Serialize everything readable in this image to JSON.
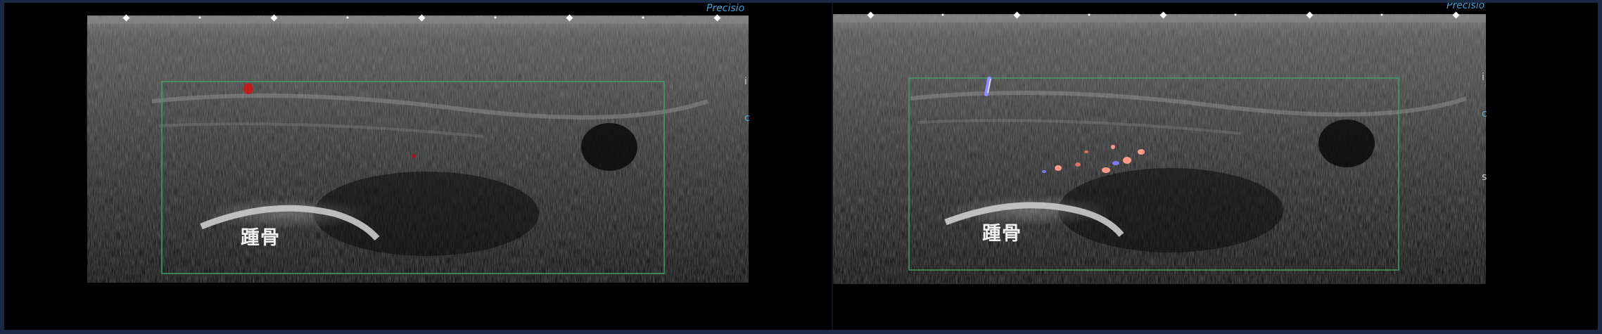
{
  "panels": [
    {
      "id": "left",
      "structure_label": "踵骨",
      "brand_text": "Precisio"
    },
    {
      "id": "right",
      "structure_label": "踵骨",
      "brand_text": "Precisio"
    }
  ],
  "colors": {
    "background": "#1a2a44",
    "roi_box": "#3fa06a",
    "doppler_red": "#c0201c",
    "doppler_blue": "#7a7cff",
    "doppler_pink": "#ff9a8a",
    "brand": "#3aa0d8"
  }
}
